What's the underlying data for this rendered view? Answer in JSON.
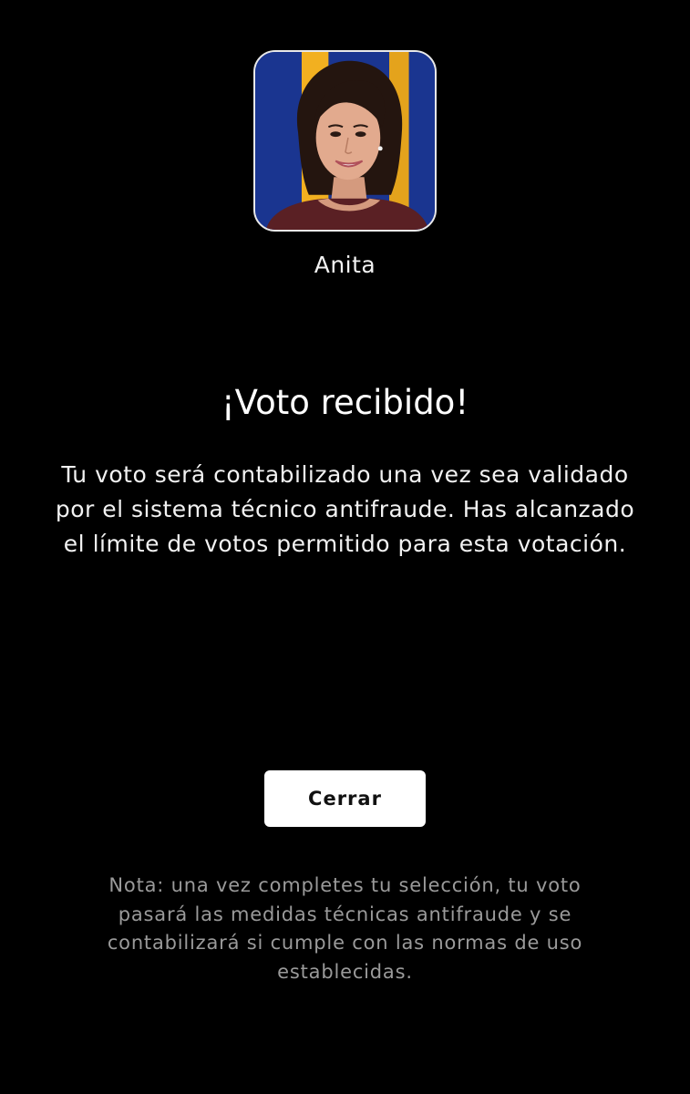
{
  "contestant": {
    "name": "Anita",
    "photo_icon": "contestant-photo"
  },
  "confirmation": {
    "title": "¡Voto recibido!",
    "message": "Tu voto será contabilizado una vez sea validado por el sistema técnico antifraude. Has alcanzado el límite de votos permitido para esta votación."
  },
  "actions": {
    "close_label": "Cerrar"
  },
  "footer": {
    "note": "Nota: una vez completes tu selección, tu voto pasará las medidas técnicas antifraude y se contabilizará si cumple con las normas de uso establecidas."
  },
  "colors": {
    "background": "#000000",
    "text": "#ffffff",
    "note_text": "#9a9a9a",
    "button_bg": "#ffffff",
    "button_text": "#111111",
    "photo_bg_blue": "#1a3590",
    "photo_bg_yellow": "#f2b020"
  }
}
